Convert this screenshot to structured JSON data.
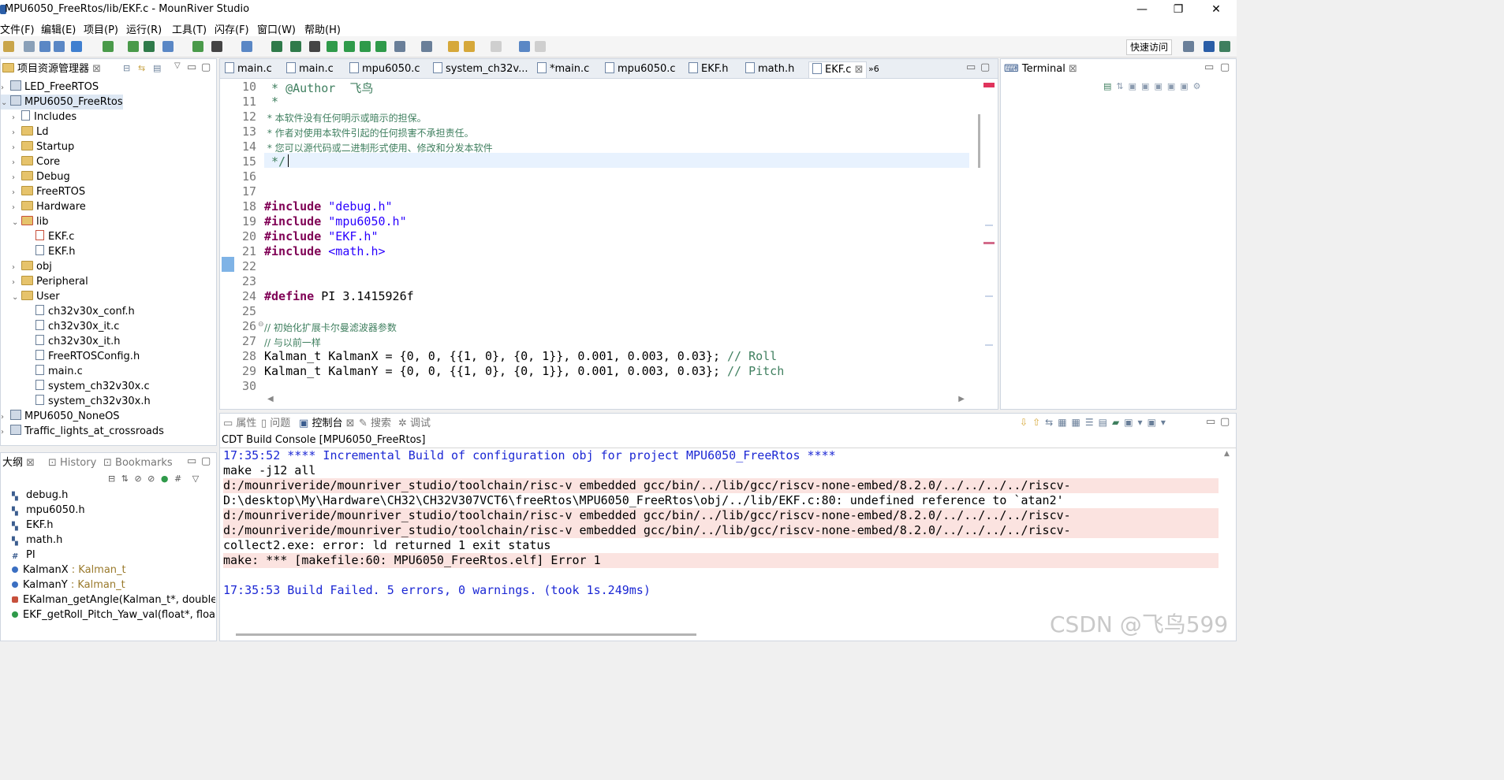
{
  "window": {
    "title": "MPU6050_FreeRtos/lib/EKF.c - MounRiver Studio",
    "minimize": "—",
    "restore": "❐",
    "close": "✕"
  },
  "menu": [
    "文件(F)",
    "编辑(E)",
    "项目(P)",
    "运行(R)",
    "工具(T)",
    "闪存(F)",
    "窗口(W)",
    "帮助(H)"
  ],
  "toolbar": {
    "quick_access": "快速访问"
  },
  "project_explorer": {
    "tab": "项目资源管理器",
    "items": [
      {
        "label": "LED_FreeRTOS",
        "kind": "project"
      },
      {
        "label": "MPU6050_FreeRtos",
        "kind": "project"
      },
      {
        "label": "Includes",
        "kind": "includes"
      },
      {
        "label": "Ld",
        "kind": "folder"
      },
      {
        "label": "Startup",
        "kind": "folder"
      },
      {
        "label": "Core",
        "kind": "folder"
      },
      {
        "label": "Debug",
        "kind": "folder"
      },
      {
        "label": "FreeRTOS",
        "kind": "folder"
      },
      {
        "label": "Hardware",
        "kind": "folder"
      },
      {
        "label": "lib",
        "kind": "folder"
      },
      {
        "label": "EKF.c",
        "kind": "c-file"
      },
      {
        "label": "EKF.h",
        "kind": "h-file"
      },
      {
        "label": "obj",
        "kind": "folder"
      },
      {
        "label": "Peripheral",
        "kind": "folder"
      },
      {
        "label": "User",
        "kind": "folder"
      },
      {
        "label": "ch32v30x_conf.h",
        "kind": "h-file"
      },
      {
        "label": "ch32v30x_it.c",
        "kind": "c-file"
      },
      {
        "label": "ch32v30x_it.h",
        "kind": "h-file"
      },
      {
        "label": "FreeRTOSConfig.h",
        "kind": "h-file"
      },
      {
        "label": "main.c",
        "kind": "c-file"
      },
      {
        "label": "system_ch32v30x.c",
        "kind": "c-file"
      },
      {
        "label": "system_ch32v30x.h",
        "kind": "h-file"
      },
      {
        "label": "MPU6050_NoneOS",
        "kind": "project"
      },
      {
        "label": "Traffic_lights_at_crossroads",
        "kind": "project"
      }
    ]
  },
  "editor": {
    "tabs": [
      "main.c",
      "main.c",
      "mpu6050.c",
      "system_ch32v...",
      "*main.c",
      "mpu6050.c",
      "EKF.h",
      "math.h",
      "EKF.c"
    ],
    "overflow": "»6",
    "line_numbers": [
      "10",
      "11",
      "12",
      "13",
      "14",
      "15",
      "16",
      "17",
      "18",
      "19",
      "20",
      "21",
      "22",
      "23",
      "24",
      "25",
      "26",
      "27",
      "28",
      "29",
      "30"
    ],
    "code": {
      "l10": " * @Author  飞鸟",
      "l11": " *",
      "l12": " * 本软件没有任何明示或暗示的担保。",
      "l13": " * 作者对使用本软件引起的任何损害不承担责任。",
      "l14": " * 您可以源代码或二进制形式使用、修改和分发本软件",
      "l15": " */",
      "inc": "#include",
      "h1": "\"debug.h\"",
      "h2": "\"mpu6050.h\"",
      "h3": "\"EKF.h\"",
      "h4": "<math.h>",
      "def": "#define",
      "defrest": " PI 3.1415926f",
      "c26": "// 初始化扩展卡尔曼滤波器参数",
      "c27": "// 与以前一样",
      "l28": "Kalman_t KalmanX = {0, 0, {{1, 0}, {0, 1}}, 0.001, 0.003, 0.03}; ",
      "l28c": "// Roll",
      "l29": "Kalman_t KalmanY = {0, 0, {{1, 0}, {0, 1}}, 0.001, 0.003, 0.03}; ",
      "l29c": "// Pitch"
    }
  },
  "terminal": {
    "tab": "Terminal"
  },
  "bottom_tabs": [
    "属性",
    "问题",
    "控制台",
    "搜索",
    "调试"
  ],
  "console": {
    "header": "CDT Build Console [MPU6050_FreeRtos]",
    "lines": [
      "17:35:52 **** Incremental Build of configuration obj for project MPU6050_FreeRtos ****",
      "make -j12 all",
      "d:/mounriveride/mounriver_studio/toolchain/risc-v embedded gcc/bin/../lib/gcc/riscv-none-embed/8.2.0/../../../../riscv-",
      "D:\\desktop\\My\\Hardware\\CH32\\CH32V307VCT6\\freeRtos\\MPU6050_FreeRtos\\obj/../lib/EKF.c:80: undefined reference to `atan2'",
      "d:/mounriveride/mounriver_studio/toolchain/risc-v embedded gcc/bin/../lib/gcc/riscv-none-embed/8.2.0/../../../../riscv-",
      "d:/mounriveride/mounriver_studio/toolchain/risc-v embedded gcc/bin/../lib/gcc/riscv-none-embed/8.2.0/../../../../riscv-",
      "collect2.exe: error: ld returned 1 exit status",
      "make: *** [makefile:60: MPU6050_FreeRtos.elf] Error 1",
      "",
      "17:35:53 Build Failed. 5 errors, 0 warnings. (took 1s.249ms)"
    ]
  },
  "outline": {
    "tabs": [
      "大纲",
      "History",
      "Bookmarks"
    ],
    "items": [
      {
        "name": "debug.h",
        "type": ""
      },
      {
        "name": "mpu6050.h",
        "type": ""
      },
      {
        "name": "EKF.h",
        "type": ""
      },
      {
        "name": "math.h",
        "type": ""
      },
      {
        "name": "PI",
        "type": ""
      },
      {
        "name": "KalmanX",
        "type": " : Kalman_t"
      },
      {
        "name": "KalmanY",
        "type": " : Kalman_t"
      },
      {
        "name": "EKalman_getAngle(Kalman_t*, double, c",
        "type": ""
      },
      {
        "name": "EKF_getRoll_Pitch_Yaw_val(float*, float*,",
        "type": ""
      }
    ]
  },
  "watermark": "CSDN @飞鸟599",
  "colors": {
    "accent": "#1b27d4",
    "error_bg": "#fbe3e0",
    "keyword": "#7f0055",
    "string": "#2a00ff",
    "comment": "#3f7f5f"
  }
}
